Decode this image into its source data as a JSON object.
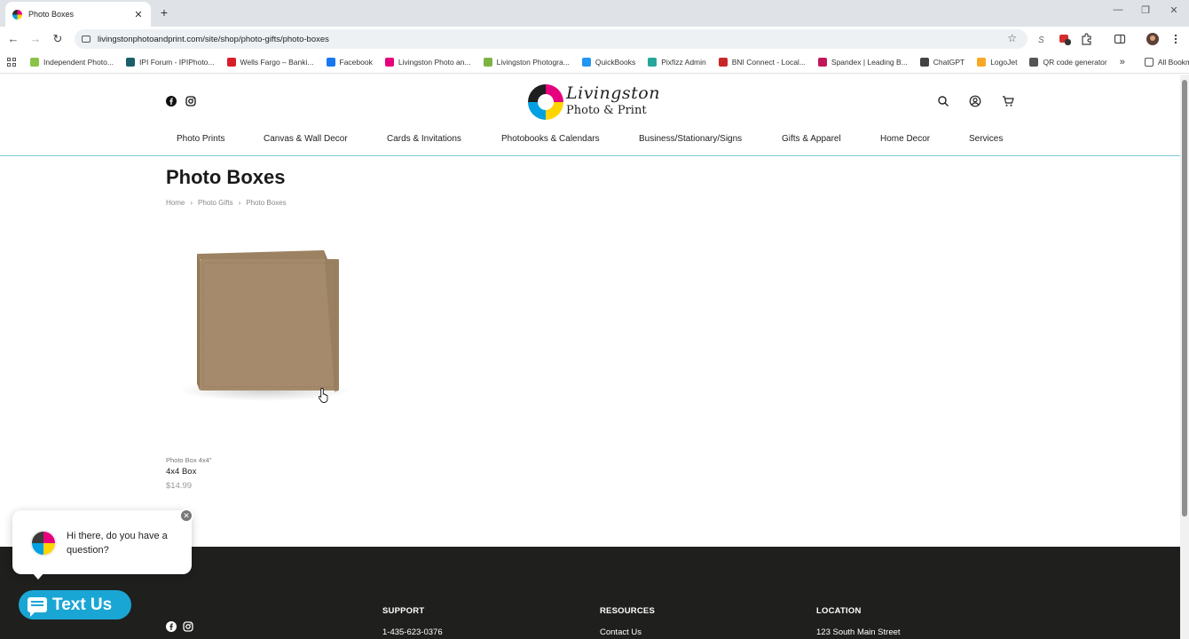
{
  "browser": {
    "tab_title": "Photo Boxes",
    "tab_close": "✕",
    "new_tab": "+",
    "url": "livingstonphotoandprint.com/site/shop/photo-gifts/photo-boxes",
    "bookmarks": [
      {
        "label": "Independent Photo...",
        "color": "#8bc34a"
      },
      {
        "label": "IPI Forum - IPIPhoto...",
        "color": "#1b5e6b"
      },
      {
        "label": "Wells Fargo – Banki...",
        "color": "#d71e28"
      },
      {
        "label": "Facebook",
        "color": "#1877f2"
      },
      {
        "label": "Livingston Photo an...",
        "color": "#e6007e"
      },
      {
        "label": "Livingston Photogra...",
        "color": "#7cb342"
      },
      {
        "label": "QuickBooks",
        "color": "#2196f3"
      },
      {
        "label": "Pixfizz Admin",
        "color": "#26a69a"
      },
      {
        "label": "BNI Connect - Local...",
        "color": "#c62828"
      },
      {
        "label": "Spandex | Leading B...",
        "color": "#c2185b"
      },
      {
        "label": "ChatGPT",
        "color": "#444444"
      },
      {
        "label": "LogoJet",
        "color": "#f9a825"
      },
      {
        "label": "QR code generator",
        "color": "#555555"
      }
    ],
    "more_bookmarks": "»",
    "all_bookmarks": "All Bookmarks"
  },
  "logo": {
    "script": "Livingston",
    "sub": "Photo & Print"
  },
  "nav": [
    "Photo Prints",
    "Canvas & Wall Decor",
    "Cards & Invitations",
    "Photobooks & Calendars",
    "Business/Stationary/Signs",
    "Gifts & Apparel",
    "Home Decor",
    "Services"
  ],
  "page": {
    "title": "Photo Boxes",
    "breadcrumbs": [
      "Home",
      "Photo Gifts",
      "Photo Boxes"
    ],
    "breadcrumb_sep": "›"
  },
  "product": {
    "subtitle": "Photo Box 4x4\"",
    "name": "4x4 Box",
    "price": "$14.99"
  },
  "chat": {
    "message": "Hi there, do you have a question?",
    "close": "✕",
    "button": "Text Us"
  },
  "footer": {
    "support": {
      "heading": "SUPPORT",
      "value": "1-435-623-0376"
    },
    "resources": {
      "heading": "RESOURCES",
      "value": "Contact Us"
    },
    "location": {
      "heading": "LOCATION",
      "value": "123 South Main Street"
    }
  },
  "colors": {
    "accent": "#1aa6d4",
    "footer_bg": "#1f1f1d",
    "nav_rule": "#7ec8d8"
  }
}
